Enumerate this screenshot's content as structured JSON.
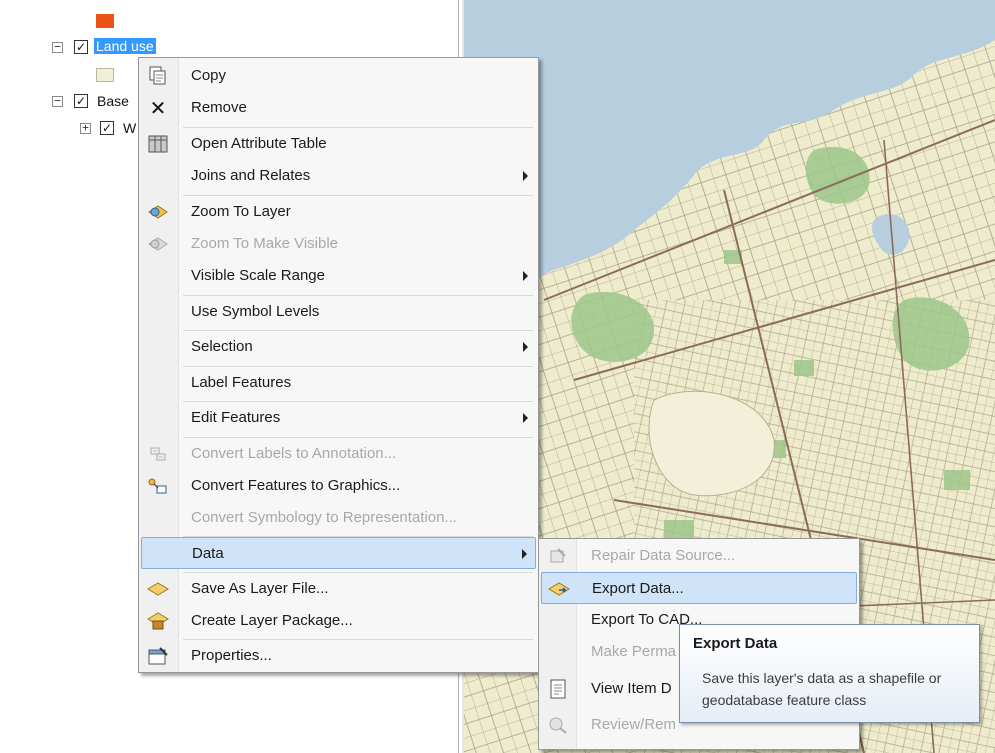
{
  "toc": {
    "layers": [
      {
        "label": "Land use",
        "selected": true
      },
      {
        "label": "Base",
        "selected": false
      },
      {
        "label": "W",
        "selected": false
      }
    ],
    "colors": {
      "land_use_swatch_top": "#e8531a",
      "land_use_swatch": "#eef0d8",
      "selection": "#3399ff"
    }
  },
  "context_menu": {
    "items": [
      {
        "label": "Copy",
        "icon": "copy-icon",
        "enabled": true,
        "has_submenu": false
      },
      {
        "label": "Remove",
        "icon": "remove-x-icon",
        "enabled": true,
        "has_submenu": false
      },
      {
        "label": "Open Attribute Table",
        "icon": "table-icon",
        "enabled": true,
        "has_submenu": false
      },
      {
        "label": "Joins and Relates",
        "icon": null,
        "enabled": true,
        "has_submenu": true
      },
      {
        "label": "Zoom To Layer",
        "icon": "zoom-to-layer-icon",
        "enabled": true,
        "has_submenu": false
      },
      {
        "label": "Zoom To Make Visible",
        "icon": "zoom-visible-icon",
        "enabled": false,
        "has_submenu": false
      },
      {
        "label": "Visible Scale Range",
        "icon": null,
        "enabled": true,
        "has_submenu": true
      },
      {
        "label": "Use Symbol Levels",
        "icon": null,
        "enabled": true,
        "has_submenu": false
      },
      {
        "label": "Selection",
        "icon": null,
        "enabled": true,
        "has_submenu": true
      },
      {
        "label": "Label Features",
        "icon": null,
        "enabled": true,
        "has_submenu": false
      },
      {
        "label": "Edit Features",
        "icon": null,
        "enabled": true,
        "has_submenu": true
      },
      {
        "label": "Convert Labels to Annotation...",
        "icon": "convert-labels-icon",
        "enabled": false,
        "has_submenu": false
      },
      {
        "label": "Convert Features to Graphics...",
        "icon": "convert-graphics-icon",
        "enabled": true,
        "has_submenu": false
      },
      {
        "label": "Convert Symbology to Representation...",
        "icon": null,
        "enabled": false,
        "has_submenu": false
      },
      {
        "label": "Data",
        "icon": null,
        "enabled": true,
        "has_submenu": true,
        "highlighted": true
      },
      {
        "label": "Save As Layer File...",
        "icon": "layer-file-icon",
        "enabled": true,
        "has_submenu": false
      },
      {
        "label": "Create Layer Package...",
        "icon": "layer-package-icon",
        "enabled": true,
        "has_submenu": false
      },
      {
        "label": "Properties...",
        "icon": "properties-icon",
        "enabled": true,
        "has_submenu": false
      }
    ]
  },
  "submenu": {
    "items": [
      {
        "label": "Repair Data Source...",
        "icon": "repair-data-source-icon",
        "enabled": false
      },
      {
        "label": "Export Data...",
        "icon": "export-data-icon",
        "enabled": true,
        "highlighted": true
      },
      {
        "label": "Export To CAD...",
        "icon": null,
        "enabled": true
      },
      {
        "label": "Make Perma",
        "icon": null,
        "enabled": false
      },
      {
        "label": "View Item D",
        "icon": "item-description-icon",
        "enabled": true
      },
      {
        "label": "Review/Rem",
        "icon": "review-icon",
        "enabled": false
      }
    ]
  },
  "tooltip": {
    "title": "Export Data",
    "body": "Save this layer's data as a shapefile or geodatabase feature class"
  }
}
